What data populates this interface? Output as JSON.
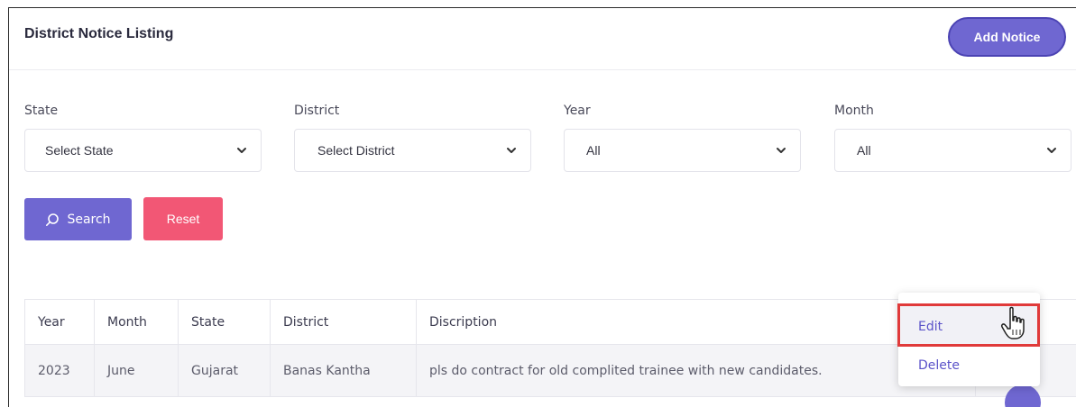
{
  "header": {
    "title": "District Notice Listing",
    "add_button_label": "Add Notice"
  },
  "filters": {
    "state": {
      "label": "State",
      "value": "Select State"
    },
    "district": {
      "label": "District",
      "value": "Select District"
    },
    "year": {
      "label": "Year",
      "value": "All"
    },
    "month": {
      "label": "Month",
      "value": "All"
    }
  },
  "buttons": {
    "search_label": "Search",
    "reset_label": "Reset"
  },
  "table": {
    "columns": [
      "Year",
      "Month",
      "State",
      "District",
      "Discription"
    ],
    "rows": [
      [
        "2023",
        "June",
        "Gujarat",
        "Banas Kantha",
        "pls do contract for old complited trainee with new candidates."
      ]
    ]
  },
  "action_menu": {
    "edit_label": "Edit",
    "delete_label": "Delete"
  },
  "colors": {
    "primary": "#6f67d1",
    "danger": "#f25775",
    "highlight_border": "#e03a3a"
  },
  "icons": {
    "search": "search-icon",
    "chevron": "chevron-down-icon",
    "cursor": "hand-pointer-icon"
  }
}
